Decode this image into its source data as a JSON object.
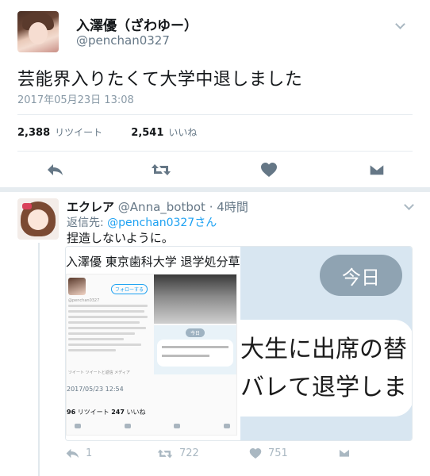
{
  "main_tweet": {
    "display_name": "入澤優（ざわゆー）",
    "handle": "@penchan0327",
    "text": "芸能界入りたくて大学中退しました",
    "timestamp": "2017年05月23日 13:08",
    "retweets_count": "2,388",
    "retweets_label": "リツイート",
    "likes_count": "2,541",
    "likes_label": "いいね",
    "actions": [
      "reply-icon",
      "retweet-icon",
      "like-icon",
      "dm-icon"
    ]
  },
  "reply_tweet": {
    "display_name": "エクレア",
    "handle": "@Anna_botbot",
    "separator": "·",
    "time_ago": "4時間",
    "reply_to_prefix": "返信先:",
    "reply_to_handle": "@penchan0327さん",
    "text": "捏造しないように。",
    "media": {
      "left_title": "入澤優 東京歯科大学 退学処分草",
      "embedded_date": "2017/05/23 12:54",
      "embedded_rt_count": "96",
      "embedded_rt_label": "リツイート",
      "embedded_like_count": "247",
      "embedded_like_label": "いいね",
      "embedded_follow": "フォローする",
      "embedded_tabs": "ツイート    ツイートと返信    メディア",
      "embedded_today": "今日",
      "today_label": "今日",
      "chat_line_1": "大生に出席の替",
      "chat_line_2": "バレて退学しま"
    },
    "reply_count": "1",
    "retweet_count": "722",
    "like_count": "751"
  },
  "colors": {
    "accent": "#1da1f2",
    "muted": "#657786",
    "icon": "#657786",
    "light_icon": "#aab8c2",
    "divider": "#e6ecf0"
  }
}
